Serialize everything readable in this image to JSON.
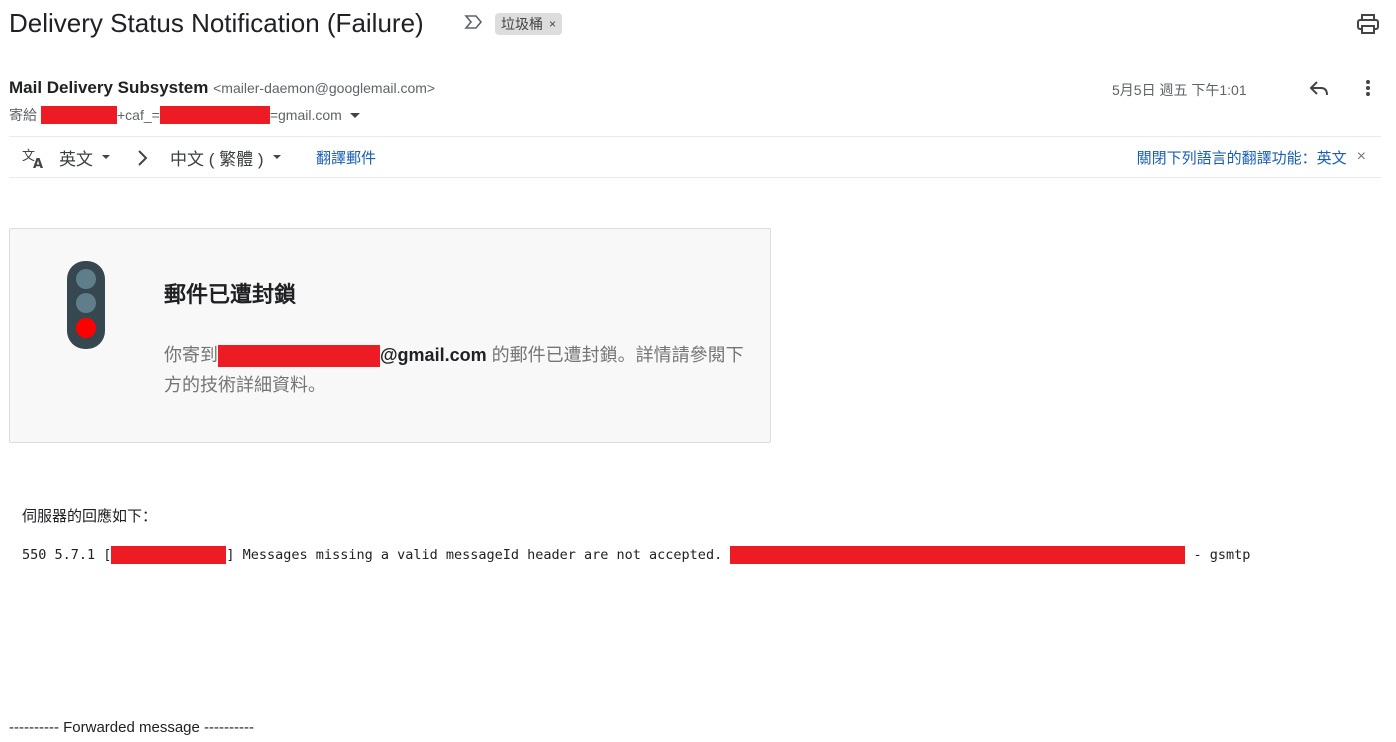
{
  "header": {
    "subject": "Delivery Status Notification (Failure)",
    "label_chip": "垃圾桶",
    "label_remove": "×"
  },
  "sender": {
    "name": "Mail Delivery Subsystem",
    "email": "<mailer-daemon@googlemail.com>",
    "to_prefix": "寄給",
    "to_middle": "+caf_=",
    "to_suffix": "=gmail.com",
    "date": "5月5日 週五 下午1:01"
  },
  "translate": {
    "source_lang": "英文",
    "arrow": ">",
    "target_lang": "中文 ( 繁體 )",
    "translate_link": "翻譯郵件",
    "disable_link": "關閉下列語言的翻譯功能：英文",
    "close": "×"
  },
  "card": {
    "title": "郵件已遭封鎖",
    "msg_prefix": "你寄到",
    "msg_email": "@gmail.com",
    "msg_suffix": " 的郵件已遭封鎖。詳情請參閱下方的技術詳細資料。"
  },
  "server": {
    "intro": "伺服器的回應如下：",
    "code": "550 5.7.1 [",
    "message": "] Messages missing a valid messageId header are not accepted. ",
    "tail": " - gsmtp"
  },
  "forwarded": "---------- Forwarded message ----------",
  "colors": {
    "redaction": "#ed1c24",
    "link": "#1a5fb4",
    "traffic_red": "#ff0000"
  }
}
